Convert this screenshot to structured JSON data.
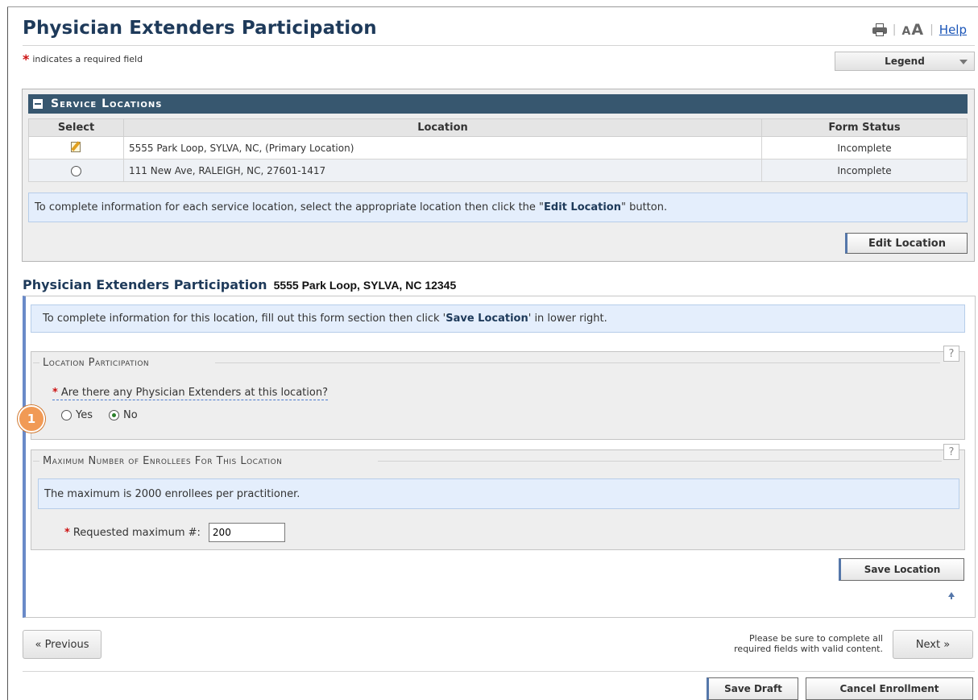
{
  "header": {
    "title": "Physician Extenders Participation",
    "text_size_label": "A",
    "text_size_label_big": "A",
    "help_label": "Help",
    "required_note": "indicates a required field",
    "required_marker": "*",
    "legend_label": "Legend"
  },
  "service_locations": {
    "title": "Service Locations",
    "columns": [
      "Select",
      "Location",
      "Form Status"
    ],
    "rows": [
      {
        "location": "5555 Park Loop, SYLVA, NC,  (Primary Location)",
        "status": "Incomplete",
        "selector": "edit-icon"
      },
      {
        "location": "111 New Ave, RALEIGH, NC, 27601-1417",
        "status": "Incomplete",
        "selector": "radio"
      }
    ],
    "info_pre": "To complete information for each service location, select the appropriate location then click the \"",
    "info_bold": "Edit Location",
    "info_post": "\" button.",
    "edit_button": "Edit Location"
  },
  "form": {
    "title": "Physician Extenders Participation",
    "address": "5555 Park Loop, SYLVA, NC 12345",
    "info_pre": "To complete information for this location, fill out this form section then click '",
    "info_bold": "Save Location",
    "info_post": "' in lower right.",
    "participation": {
      "legend": "Location Participation",
      "question": "Are there any Physician Extenders at this location?",
      "options": [
        "Yes",
        "No"
      ],
      "selected": "No",
      "help": "?"
    },
    "maximum": {
      "legend": "Maximum Number of Enrollees For This Location",
      "info": "The maximum is 2000 enrollees per practitioner.",
      "label": "Requested maximum #:",
      "value": "200",
      "help": "?"
    },
    "save_button": "Save Location",
    "callout": "1"
  },
  "footer": {
    "previous": "« Previous",
    "next": "Next »",
    "note_line1": "Please be sure to complete all",
    "note_line2": "required fields with valid content.",
    "save_draft": "Save Draft",
    "cancel": "Cancel Enrollment"
  },
  "colors": {
    "title": "#1e3a5a",
    "panel_header": "#37576f",
    "required": "#cc1111",
    "info_bg": "#e4eefc",
    "accent": "#5577aa",
    "callout": "#f19a55"
  }
}
